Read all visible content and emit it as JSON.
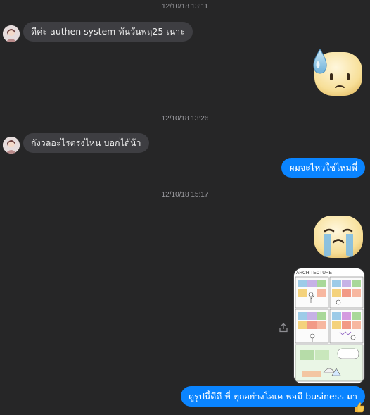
{
  "messages": {
    "ts1": "12/10/18 13:11",
    "msg1": "ดีค่ะ authen system ทันวันพฤ25 เนาะ",
    "ts2": "12/10/18 13:26",
    "msg2": "กังวลอะไรตรงไหน บอกได้น้า",
    "msg3": "ผมจะไหวใช่ไหมพี่",
    "ts3": "12/10/18 15:17",
    "msg4": "ดูรูปนี้ดีดี พี่ ทุกอย่างโอเค พอมี business มา"
  },
  "comic": {
    "title": "ARCHITECTURE"
  },
  "icons": {
    "avatar": "contact-avatar",
    "sweat_emoji": "sweat-face-emoji",
    "cry_emoji": "crying-face-emoji",
    "share": "share-icon",
    "like": "thumbs-up-icon"
  },
  "colors": {
    "background": "#262627",
    "incoming_bubble": "#3e3e42",
    "outgoing_bubble": "#0a84ff",
    "timestamp": "#9a9a9f"
  }
}
